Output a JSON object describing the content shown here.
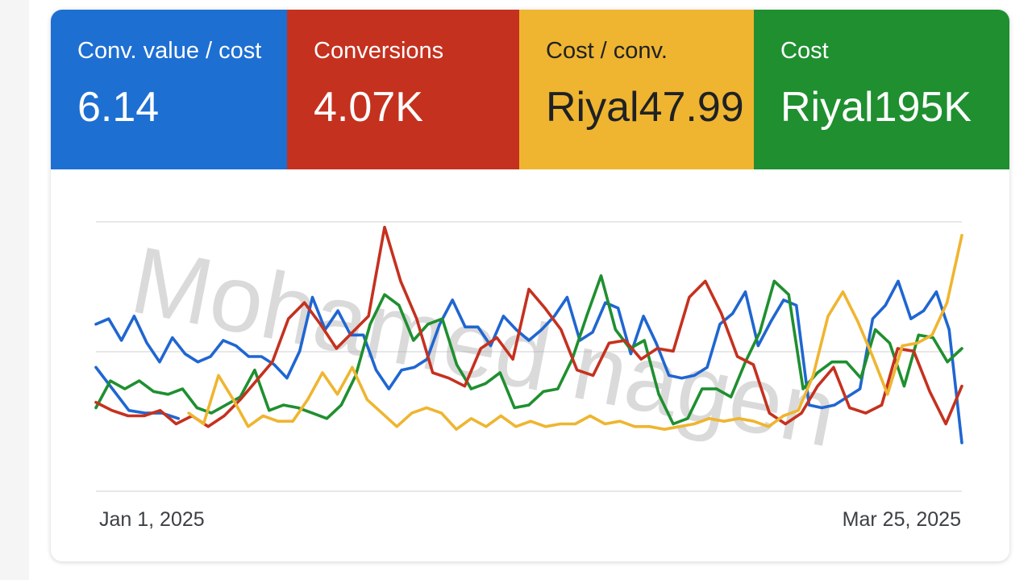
{
  "tiles": [
    {
      "label": "Conv. value / cost",
      "value": "6.14",
      "color": "#1e6fd2"
    },
    {
      "label": "Conversions",
      "value": "4.07K",
      "color": "#c5311f"
    },
    {
      "label": "Cost / conv.",
      "value": "Riyal47.99",
      "color": "#efb530"
    },
    {
      "label": "Cost",
      "value": "Riyal195K",
      "color": "#1f8f30"
    }
  ],
  "watermark": "Mohamed nagen",
  "chart_data": {
    "type": "line",
    "x_start": "Jan 1, 2025",
    "x_end": "Mar 25, 2025",
    "grid": true,
    "x": [
      0,
      1,
      2,
      3,
      4,
      5,
      6,
      7,
      8,
      9,
      10,
      11,
      12,
      13,
      14,
      15,
      16,
      17,
      18,
      19,
      20,
      21,
      22,
      23,
      24,
      25,
      26,
      27,
      28,
      29,
      30,
      31,
      32,
      33,
      34,
      35,
      36,
      37,
      38,
      39,
      40,
      41,
      42,
      43,
      44,
      45,
      46,
      47,
      48,
      49,
      50,
      51,
      52,
      53,
      54,
      55,
      56,
      57,
      58,
      59,
      60,
      61,
      62,
      63,
      64,
      65,
      66,
      67,
      68,
      69,
      70,
      71,
      72,
      73,
      74,
      75,
      76,
      77,
      78,
      79,
      80,
      81,
      82,
      83,
      84
    ],
    "ylim": [
      0,
      100
    ],
    "series": [
      {
        "color": "#1f66d1",
        "values": [
          62,
          64,
          56,
          65,
          55,
          48,
          57,
          51,
          48,
          50,
          56,
          54,
          50,
          50,
          47,
          42,
          52,
          72,
          60,
          67,
          58,
          58,
          45,
          38,
          45,
          46,
          49,
          62,
          71,
          61,
          61,
          54,
          65,
          60,
          56,
          60,
          65,
          72,
          56,
          59,
          70,
          68,
          51,
          65,
          55,
          43,
          42,
          43,
          46,
          62,
          66,
          74,
          54,
          63,
          71,
          69,
          32,
          31,
          32,
          35,
          38,
          64,
          69,
          78,
          64,
          67,
          74,
          60,
          18
        ]
      },
      {
        "color": "#1f66d1",
        "values": [
          46,
          38,
          30,
          29,
          29,
          27
        ]
      },
      {
        "color": "#1f8f30",
        "values": [
          31,
          41,
          38,
          41,
          37,
          36,
          38,
          31,
          29,
          32,
          35,
          45,
          30,
          32,
          31,
          29,
          27,
          32,
          43,
          62,
          73,
          69,
          56,
          62,
          64,
          47,
          38,
          40,
          44,
          31,
          32,
          37,
          38,
          49,
          65,
          80,
          60,
          53,
          56,
          36,
          25,
          27,
          38,
          38,
          35,
          48,
          59,
          78,
          73,
          38,
          44,
          48,
          48,
          42,
          60,
          55,
          39,
          58,
          57,
          48,
          53
        ]
      },
      {
        "color": "#c5311f",
        "values": [
          33,
          30,
          28,
          28,
          30,
          25,
          28,
          24,
          28,
          34,
          41,
          48,
          64,
          70,
          62,
          53,
          59,
          65,
          98,
          78,
          64,
          44,
          42,
          39,
          53,
          57,
          49,
          75,
          68,
          60,
          45,
          43,
          55,
          56,
          49,
          53,
          52,
          72,
          78,
          66,
          50,
          47,
          29,
          25,
          29,
          39,
          46,
          31,
          29,
          32,
          53,
          52,
          37,
          25,
          39
        ]
      },
      {
        "color": "#efb530",
        "values": [
          29,
          25,
          43,
          34,
          24,
          28,
          26,
          26,
          34,
          44,
          36,
          46,
          34,
          29,
          24,
          29,
          31,
          29,
          23,
          27,
          24,
          28,
          24,
          26,
          24,
          25,
          25,
          28,
          25,
          26,
          24,
          24,
          23,
          24,
          25,
          27,
          26,
          27,
          26,
          24,
          28,
          30,
          43,
          65,
          74,
          63,
          50,
          36,
          54,
          55,
          58,
          70,
          95
        ]
      }
    ]
  }
}
